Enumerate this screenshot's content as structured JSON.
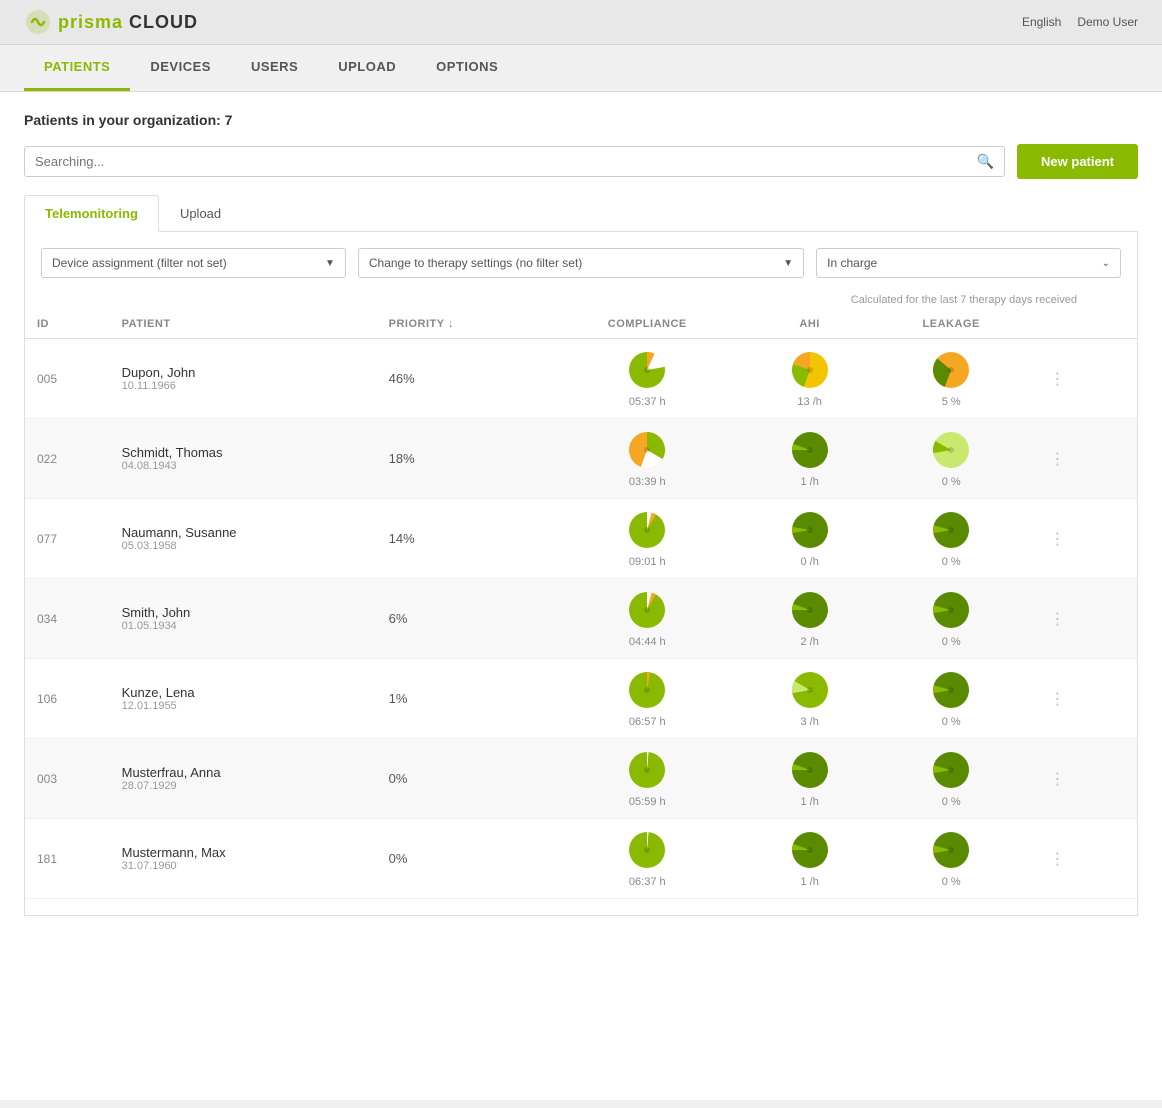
{
  "app": {
    "logo_text": "prisma CLOUD",
    "lang": "English",
    "user": "Demo User"
  },
  "nav": {
    "items": [
      {
        "label": "PATIENTS",
        "active": true
      },
      {
        "label": "DEVICES",
        "active": false
      },
      {
        "label": "USERS",
        "active": false
      },
      {
        "label": "UPLOAD",
        "active": false
      },
      {
        "label": "OPTIONS",
        "active": false
      }
    ]
  },
  "page": {
    "title": "Patients in your organization: 7",
    "search_placeholder": "Searching...",
    "new_patient_label": "New patient"
  },
  "tabs": [
    {
      "label": "Telemonitoring",
      "active": true
    },
    {
      "label": "Upload",
      "active": false
    }
  ],
  "filters": {
    "device_assignment": "Device assignment (filter not set)",
    "therapy_settings": "Change to therapy settings (no filter set)",
    "in_charge": "In charge"
  },
  "table": {
    "calc_note": "Calculated for the last 7 therapy days received",
    "columns": [
      "ID",
      "PATIENT",
      "PRIORITY ↓",
      "COMPLIANCE",
      "AHI",
      "LEAKAGE"
    ],
    "rows": [
      {
        "id": "005",
        "name": "Dupon, John",
        "dob": "10.11.1966",
        "priority": "46%",
        "compliance_value": "05:37 h",
        "ahi_value": "13 /h",
        "leakage_value": "5 %",
        "compliance_pct": 46,
        "ahi_level": "high",
        "leakage_level": "high"
      },
      {
        "id": "022",
        "name": "Schmidt, Thomas",
        "dob": "04.08.1943",
        "priority": "18%",
        "compliance_value": "03:39 h",
        "ahi_value": "1 /h",
        "leakage_value": "0 %",
        "compliance_pct": 18,
        "ahi_level": "low",
        "leakage_level": "vlow"
      },
      {
        "id": "077",
        "name": "Naumann, Susanne",
        "dob": "05.03.1958",
        "priority": "14%",
        "compliance_value": "09:01 h",
        "ahi_value": "0 /h",
        "leakage_value": "0 %",
        "compliance_pct": 14,
        "ahi_level": "zero",
        "leakage_level": "zero"
      },
      {
        "id": "034",
        "name": "Smith, John",
        "dob": "01.05.1934",
        "priority": "6%",
        "compliance_value": "04:44 h",
        "ahi_value": "2 /h",
        "leakage_value": "0 %",
        "compliance_pct": 6,
        "ahi_level": "low",
        "leakage_level": "zero"
      },
      {
        "id": "106",
        "name": "Kunze, Lena",
        "dob": "12.01.1955",
        "priority": "1%",
        "compliance_value": "06:57 h",
        "ahi_value": "3 /h",
        "leakage_value": "0 %",
        "compliance_pct": 1,
        "ahi_level": "vlow",
        "leakage_level": "zero"
      },
      {
        "id": "003",
        "name": "Musterfrau, Anna",
        "dob": "28.07.1929",
        "priority": "0%",
        "compliance_value": "05:59 h",
        "ahi_value": "1 /h",
        "leakage_value": "0 %",
        "compliance_pct": 0,
        "ahi_level": "low",
        "leakage_level": "zero"
      },
      {
        "id": "181",
        "name": "Mustermann, Max",
        "dob": "31.07.1960",
        "priority": "0%",
        "compliance_value": "06:37 h",
        "ahi_value": "1 /h",
        "leakage_value": "0 %",
        "compliance_pct": 0,
        "ahi_level": "low",
        "leakage_level": "zero"
      }
    ]
  }
}
